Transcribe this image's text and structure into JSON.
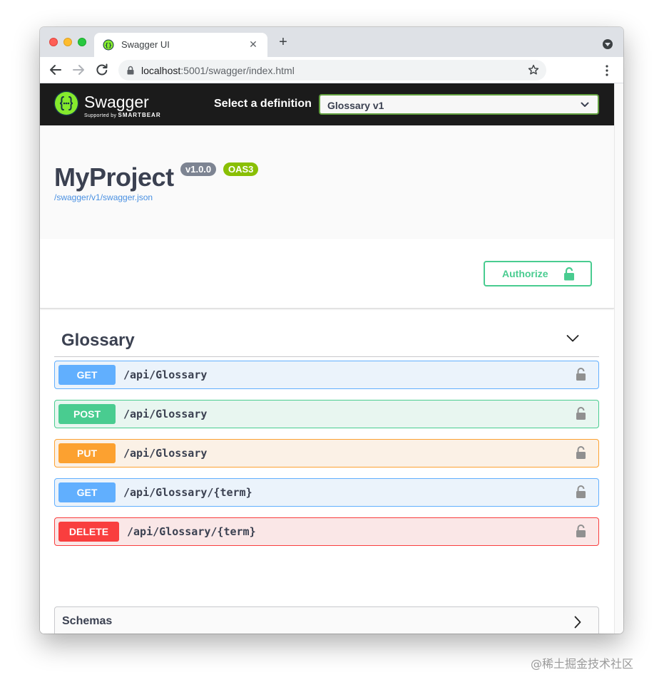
{
  "browser": {
    "tab_title": "Swagger UI",
    "tab_close": "✕",
    "new_tab": "+",
    "url_host": "localhost",
    "url_rest": ":5001/swagger/index.html"
  },
  "topbar": {
    "brand": "Swagger",
    "brand_sub_prefix": "Supported by ",
    "brand_sub_name": "SMARTBEAR",
    "definition_label": "Select a definition",
    "definition_value": "Glossary v1"
  },
  "info": {
    "title": "MyProject",
    "version": "v1.0.0",
    "oas": "OAS3",
    "spec_url": "/swagger/v1/swagger.json"
  },
  "authorize": {
    "label": "Authorize"
  },
  "tag": {
    "name": "Glossary"
  },
  "operations": [
    {
      "method": "GET",
      "path": "/api/Glossary"
    },
    {
      "method": "POST",
      "path": "/api/Glossary"
    },
    {
      "method": "PUT",
      "path": "/api/Glossary"
    },
    {
      "method": "GET",
      "path": "/api/Glossary/{term}"
    },
    {
      "method": "DELETE",
      "path": "/api/Glossary/{term}"
    }
  ],
  "schemas": {
    "label": "Schemas"
  },
  "watermark": "@稀土掘金技术社区",
  "colors": {
    "get": "#61affe",
    "post": "#49cc90",
    "put": "#fca130",
    "delete": "#f93e3e",
    "topbar": "#1b1b1b",
    "swagger_green": "#85ea2d"
  }
}
